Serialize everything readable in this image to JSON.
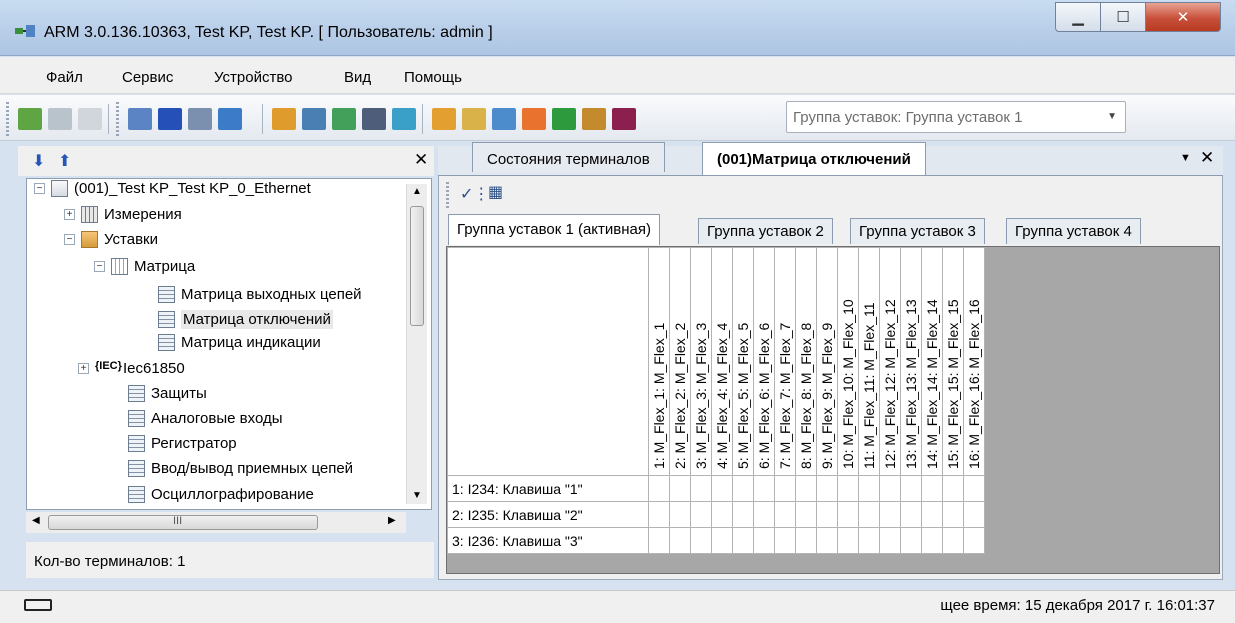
{
  "window": {
    "title": "ARM 3.0.136.10363, Test KP, Test KP. [ Пользователь: admin ]"
  },
  "menu": [
    "Файл",
    "Сервис",
    "Устройство",
    "Вид",
    "Помощь"
  ],
  "toolbar": {
    "group_combo": "Группа уставок: Группа уставок 1"
  },
  "tree": {
    "root": "(001)_Test KP_Test KP_0_Ethernet",
    "items": [
      {
        "label": "Измерения"
      },
      {
        "label": "Уставки"
      },
      {
        "label": "Матрица"
      },
      {
        "label": "Матрица выходных цепей"
      },
      {
        "label": "Матрица отключений"
      },
      {
        "label": "Матрица индикации"
      },
      {
        "label": "Iec61850"
      },
      {
        "label": "Защиты"
      },
      {
        "label": "Аналоговые входы"
      },
      {
        "label": "Регистратор"
      },
      {
        "label": "Ввод/вывод приемных цепей"
      },
      {
        "label": "Осциллографирование"
      }
    ],
    "hscroll_mark": "III"
  },
  "left_status": "Кол-во терминалов: 1",
  "doc_tabs": [
    "Состояния терминалов",
    "(001)Матрица отключений"
  ],
  "set_tabs": [
    "Группа уставок 1 (активная)",
    "Группа уставок 2",
    "Группа уставок 3",
    "Группа уставок 4"
  ],
  "matrix": {
    "columns": [
      "1: M_Flex_1: M_Flex_1",
      "2: M_Flex_2: M_Flex_2",
      "3: M_Flex_3: M_Flex_3",
      "4: M_Flex_4: M_Flex_4",
      "5: M_Flex_5: M_Flex_5",
      "6: M_Flex_6: M_Flex_6",
      "7: M_Flex_7: M_Flex_7",
      "8: M_Flex_8: M_Flex_8",
      "9: M_Flex_9: M_Flex_9",
      "10: M_Flex_10: M_Flex_10",
      "11: M_Flex_11: M_Flex_11",
      "12: M_Flex_12: M_Flex_12",
      "13: M_Flex_13: M_Flex_13",
      "14: M_Flex_14: M_Flex_14",
      "15: M_Flex_15: M_Flex_15",
      "16: M_Flex_16: M_Flex_16"
    ],
    "rows": [
      "1: I234:  Клавиша \"1\"",
      "2: I235:  Клавиша \"2\"",
      "3: I236:  Клавиша \"3\""
    ]
  },
  "status": {
    "time": "щее время: 15 декабря 2017 г. 16:01:37"
  },
  "colors": {
    "titlebar": "#b7cde8",
    "close_button": "#c8503a",
    "grid_background": "#a7a7a7"
  }
}
